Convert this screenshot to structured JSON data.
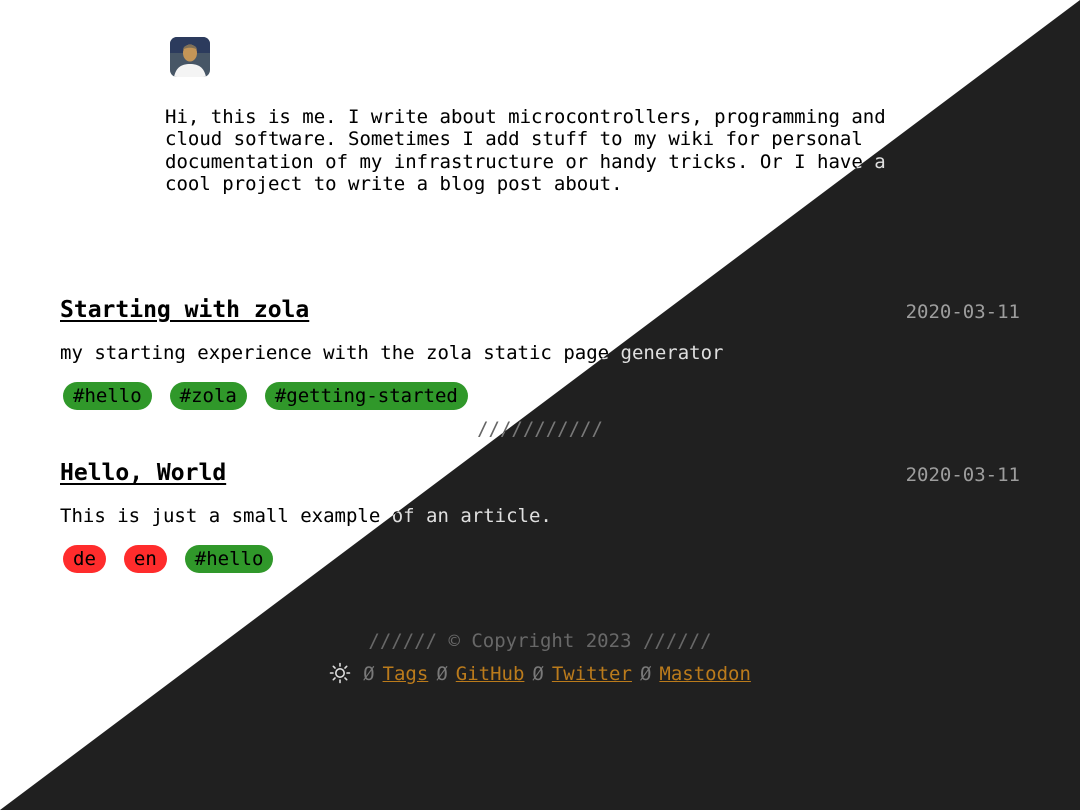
{
  "bio": {
    "text": "Hi, this is me. I write about microcontrollers, programming and\ncloud software. Sometimes I add stuff to my wiki for personal\ndocumentation of my infrastructure or handy tricks. Or I have a\ncool project to write a blog post about."
  },
  "posts": [
    {
      "title": "Starting with zola",
      "date": "2020-03-11",
      "description": "my starting experience with the zola static page generator",
      "tags": [
        {
          "label": "#hello",
          "color": "green"
        },
        {
          "label": "#zola",
          "color": "green"
        },
        {
          "label": "#getting-started",
          "color": "green"
        }
      ]
    },
    {
      "title": "Hello, World",
      "date": "2020-03-11",
      "description": "This is just a small example of an article.",
      "tags": [
        {
          "label": "de",
          "color": "red"
        },
        {
          "label": "en",
          "color": "red"
        },
        {
          "label": "#hello",
          "color": "green"
        }
      ]
    }
  ],
  "separator": "///////////",
  "footer": {
    "copyright": "////// © Copyright 2023 //////",
    "theme_icon": "sun-icon",
    "separator_glyph": "Ø",
    "links": {
      "tags": "Tags",
      "github": "GitHub",
      "twitter": "Twitter",
      "mastodon": "Mastodon"
    }
  },
  "colors": {
    "background_light": "#ffffff",
    "background_dark": "#202020",
    "tag_green": "#30982a",
    "tag_red": "#ff2c2c",
    "link": "#2464fa"
  }
}
